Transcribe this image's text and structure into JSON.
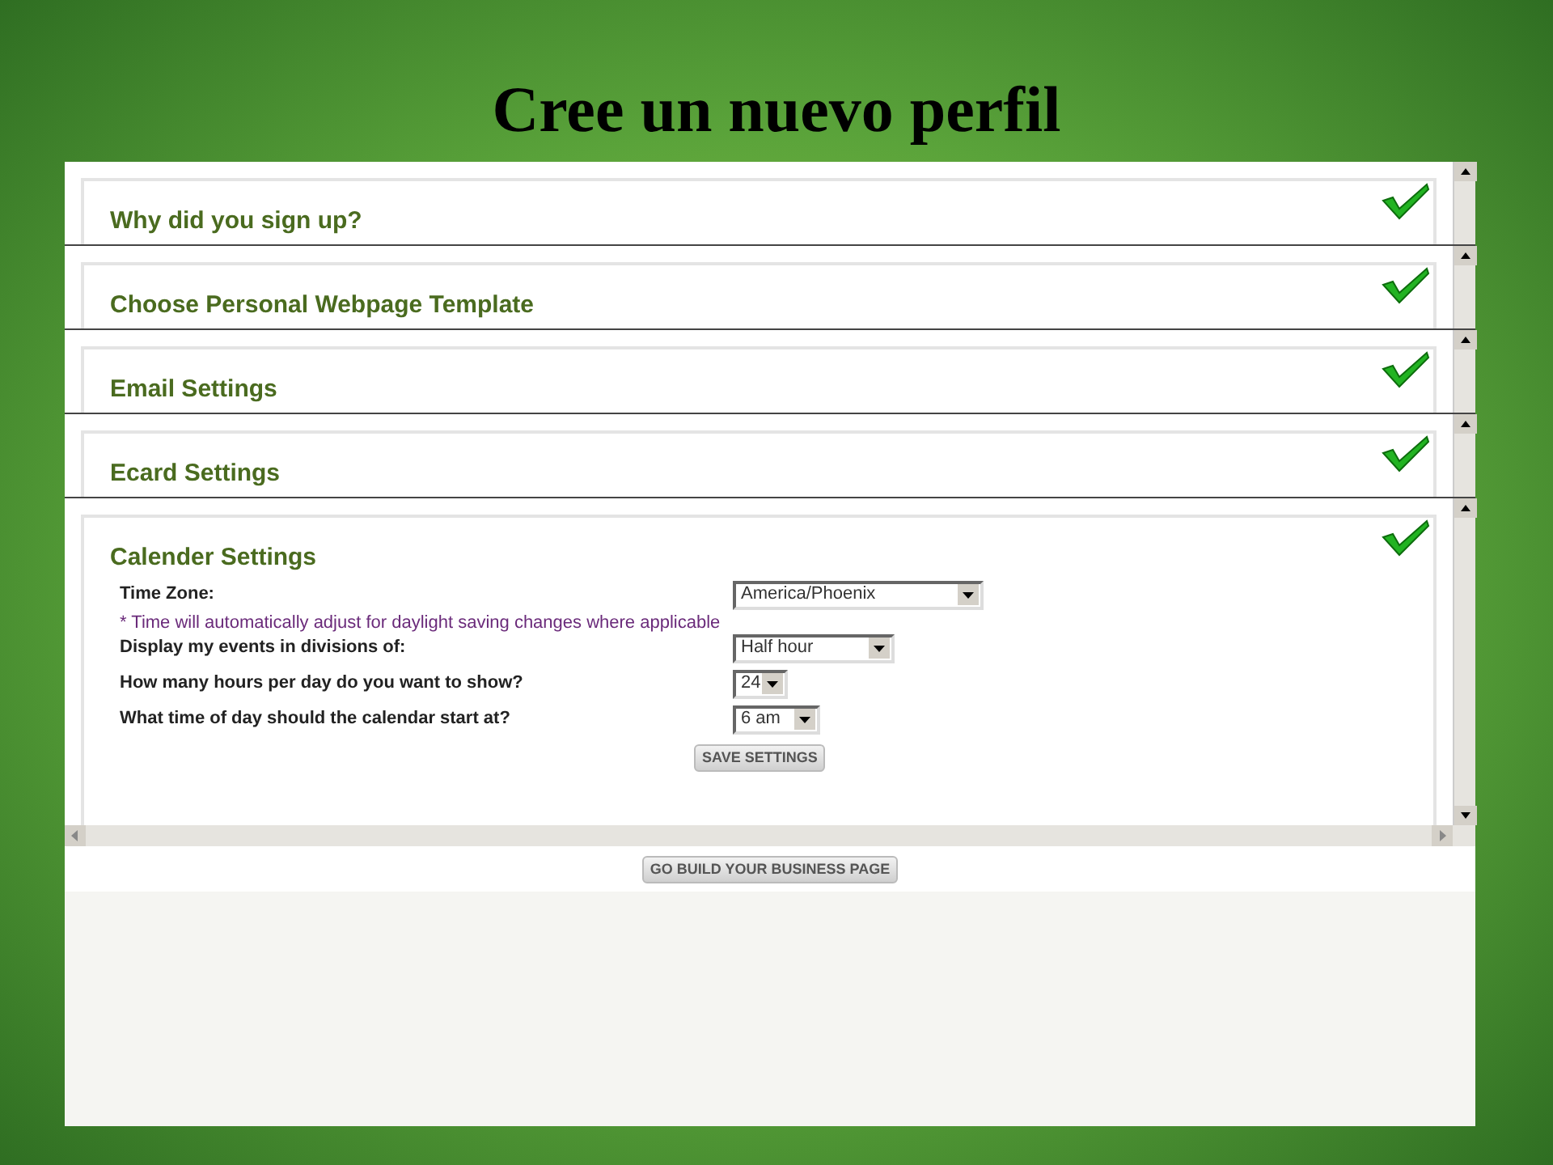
{
  "slide_title": "Cree un nuevo perfil",
  "sections": [
    {
      "title": "Why did you sign up?",
      "completed": true
    },
    {
      "title": "Choose Personal Webpage Template",
      "completed": true
    },
    {
      "title": "Email Settings",
      "completed": true
    },
    {
      "title": "Ecard Settings",
      "completed": true
    }
  ],
  "calendar": {
    "title": "Calender Settings",
    "completed": true,
    "fields": [
      {
        "label": "Time Zone:",
        "value": "America/Phoenix",
        "note": "* Time will automatically adjust for daylight saving changes where applicable"
      },
      {
        "label": "Display my events in divisions of:",
        "value": "Half hour"
      },
      {
        "label": "How many hours per day do you want to show?",
        "value": "24"
      },
      {
        "label": "What time of day should the calendar start at?",
        "value": "6 am"
      }
    ],
    "save_button": "SAVE SETTINGS"
  },
  "footer_button": "GO BUILD YOUR BUSINESS PAGE"
}
